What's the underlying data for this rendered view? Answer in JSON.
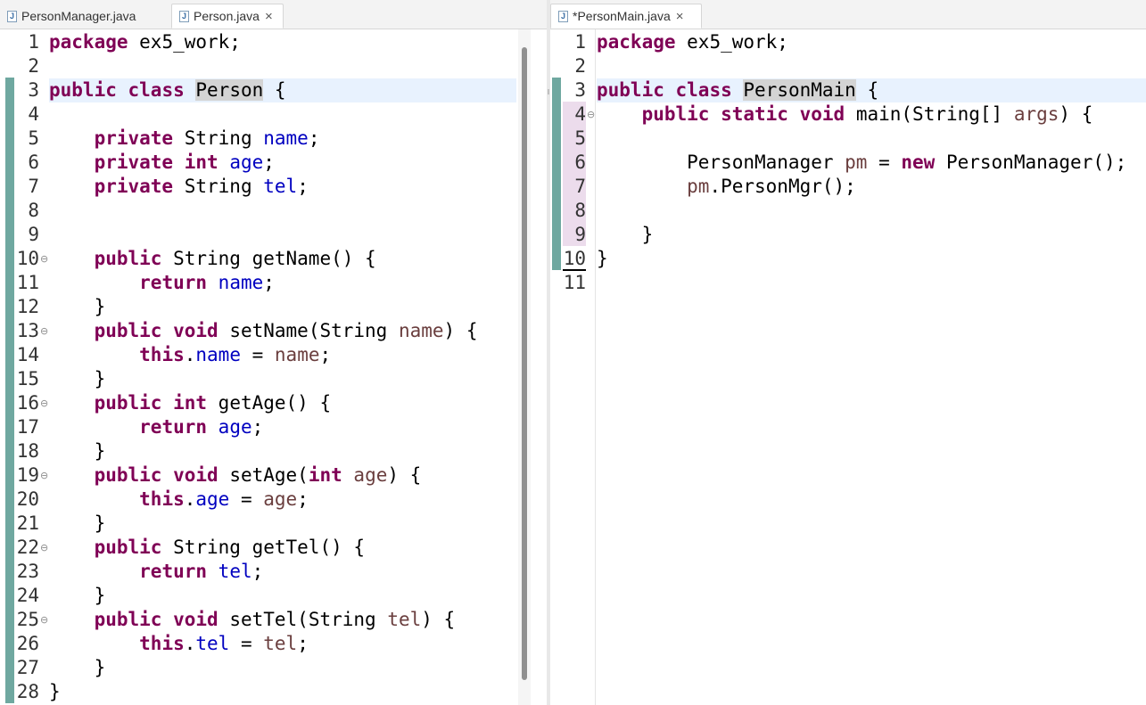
{
  "left": {
    "tabs": [
      {
        "label": "PersonManager.java",
        "active": false
      },
      {
        "label": "Person.java",
        "active": true,
        "close": "×"
      }
    ],
    "lines": [
      {
        "n": "1",
        "fold": "",
        "segs": [
          {
            "t": "package",
            "c": "kw"
          },
          {
            "t": " ex5_work;"
          }
        ]
      },
      {
        "n": "2",
        "fold": "",
        "segs": []
      },
      {
        "n": "3",
        "fold": "",
        "current": true,
        "segs": [
          {
            "t": "public",
            "c": "kw"
          },
          {
            "t": " "
          },
          {
            "t": "class",
            "c": "kw"
          },
          {
            "t": " "
          },
          {
            "t": "Person",
            "c": "hl"
          },
          {
            "t": " {"
          }
        ]
      },
      {
        "n": "4",
        "fold": "",
        "segs": []
      },
      {
        "n": "5",
        "fold": "",
        "segs": [
          {
            "t": "    "
          },
          {
            "t": "private",
            "c": "kw"
          },
          {
            "t": " String "
          },
          {
            "t": "name",
            "c": "fld"
          },
          {
            "t": ";"
          }
        ]
      },
      {
        "n": "6",
        "fold": "",
        "segs": [
          {
            "t": "    "
          },
          {
            "t": "private",
            "c": "kw"
          },
          {
            "t": " "
          },
          {
            "t": "int",
            "c": "kw"
          },
          {
            "t": " "
          },
          {
            "t": "age",
            "c": "fld"
          },
          {
            "t": ";"
          }
        ]
      },
      {
        "n": "7",
        "fold": "",
        "segs": [
          {
            "t": "    "
          },
          {
            "t": "private",
            "c": "kw"
          },
          {
            "t": " String "
          },
          {
            "t": "tel",
            "c": "fld"
          },
          {
            "t": ";"
          }
        ]
      },
      {
        "n": "8",
        "fold": "",
        "segs": []
      },
      {
        "n": "9",
        "fold": "",
        "segs": []
      },
      {
        "n": "10",
        "fold": "⊖",
        "segs": [
          {
            "t": "    "
          },
          {
            "t": "public",
            "c": "kw"
          },
          {
            "t": " String getName() {"
          }
        ]
      },
      {
        "n": "11",
        "fold": "",
        "segs": [
          {
            "t": "        "
          },
          {
            "t": "return",
            "c": "kw"
          },
          {
            "t": " "
          },
          {
            "t": "name",
            "c": "fld"
          },
          {
            "t": ";"
          }
        ]
      },
      {
        "n": "12",
        "fold": "",
        "segs": [
          {
            "t": "    }"
          }
        ]
      },
      {
        "n": "13",
        "fold": "⊖",
        "segs": [
          {
            "t": "    "
          },
          {
            "t": "public",
            "c": "kw"
          },
          {
            "t": " "
          },
          {
            "t": "void",
            "c": "kw"
          },
          {
            "t": " setName(String "
          },
          {
            "t": "name",
            "c": "par"
          },
          {
            "t": ") {"
          }
        ]
      },
      {
        "n": "14",
        "fold": "",
        "segs": [
          {
            "t": "        "
          },
          {
            "t": "this",
            "c": "kw"
          },
          {
            "t": "."
          },
          {
            "t": "name",
            "c": "fld"
          },
          {
            "t": " = "
          },
          {
            "t": "name",
            "c": "par"
          },
          {
            "t": ";"
          }
        ]
      },
      {
        "n": "15",
        "fold": "",
        "segs": [
          {
            "t": "    }"
          }
        ]
      },
      {
        "n": "16",
        "fold": "⊖",
        "segs": [
          {
            "t": "    "
          },
          {
            "t": "public",
            "c": "kw"
          },
          {
            "t": " "
          },
          {
            "t": "int",
            "c": "kw"
          },
          {
            "t": " getAge() {"
          }
        ]
      },
      {
        "n": "17",
        "fold": "",
        "segs": [
          {
            "t": "        "
          },
          {
            "t": "return",
            "c": "kw"
          },
          {
            "t": " "
          },
          {
            "t": "age",
            "c": "fld"
          },
          {
            "t": ";"
          }
        ]
      },
      {
        "n": "18",
        "fold": "",
        "segs": [
          {
            "t": "    }"
          }
        ]
      },
      {
        "n": "19",
        "fold": "⊖",
        "segs": [
          {
            "t": "    "
          },
          {
            "t": "public",
            "c": "kw"
          },
          {
            "t": " "
          },
          {
            "t": "void",
            "c": "kw"
          },
          {
            "t": " setAge("
          },
          {
            "t": "int",
            "c": "kw"
          },
          {
            "t": " "
          },
          {
            "t": "age",
            "c": "par"
          },
          {
            "t": ") {"
          }
        ]
      },
      {
        "n": "20",
        "fold": "",
        "segs": [
          {
            "t": "        "
          },
          {
            "t": "this",
            "c": "kw"
          },
          {
            "t": "."
          },
          {
            "t": "age",
            "c": "fld"
          },
          {
            "t": " = "
          },
          {
            "t": "age",
            "c": "par"
          },
          {
            "t": ";"
          }
        ]
      },
      {
        "n": "21",
        "fold": "",
        "segs": [
          {
            "t": "    }"
          }
        ]
      },
      {
        "n": "22",
        "fold": "⊖",
        "segs": [
          {
            "t": "    "
          },
          {
            "t": "public",
            "c": "kw"
          },
          {
            "t": " String getTel() {"
          }
        ]
      },
      {
        "n": "23",
        "fold": "",
        "segs": [
          {
            "t": "        "
          },
          {
            "t": "return",
            "c": "kw"
          },
          {
            "t": " "
          },
          {
            "t": "tel",
            "c": "fld"
          },
          {
            "t": ";"
          }
        ]
      },
      {
        "n": "24",
        "fold": "",
        "segs": [
          {
            "t": "    }"
          }
        ]
      },
      {
        "n": "25",
        "fold": "⊖",
        "segs": [
          {
            "t": "    "
          },
          {
            "t": "public",
            "c": "kw"
          },
          {
            "t": " "
          },
          {
            "t": "void",
            "c": "kw"
          },
          {
            "t": " setTel(String "
          },
          {
            "t": "tel",
            "c": "par"
          },
          {
            "t": ") {"
          }
        ]
      },
      {
        "n": "26",
        "fold": "",
        "segs": [
          {
            "t": "        "
          },
          {
            "t": "this",
            "c": "kw"
          },
          {
            "t": "."
          },
          {
            "t": "tel",
            "c": "fld"
          },
          {
            "t": " = "
          },
          {
            "t": "tel",
            "c": "par"
          },
          {
            "t": ";"
          }
        ]
      },
      {
        "n": "27",
        "fold": "",
        "segs": [
          {
            "t": "    }"
          }
        ]
      },
      {
        "n": "28",
        "fold": "",
        "segs": [
          {
            "t": "}"
          }
        ]
      }
    ]
  },
  "right": {
    "tabs": [
      {
        "label": "*PersonMain.java",
        "active": true,
        "close": "×"
      }
    ],
    "lines": [
      {
        "n": "1",
        "fold": "",
        "segs": [
          {
            "t": "package",
            "c": "kw"
          },
          {
            "t": " ex5_work;"
          }
        ]
      },
      {
        "n": "2",
        "fold": "",
        "segs": []
      },
      {
        "n": "3",
        "fold": "",
        "current": true,
        "segs": [
          {
            "t": "public",
            "c": "kw"
          },
          {
            "t": " "
          },
          {
            "t": "class",
            "c": "kw"
          },
          {
            "t": " "
          },
          {
            "t": "PersonMain",
            "c": "hl"
          },
          {
            "t": " {"
          }
        ]
      },
      {
        "n": "4",
        "fold": "⊖",
        "segs": [
          {
            "t": "    "
          },
          {
            "t": "public",
            "c": "kw"
          },
          {
            "t": " "
          },
          {
            "t": "static",
            "c": "kw"
          },
          {
            "t": " "
          },
          {
            "t": "void",
            "c": "kw"
          },
          {
            "t": " main(String[] "
          },
          {
            "t": "args",
            "c": "par"
          },
          {
            "t": ") {"
          }
        ]
      },
      {
        "n": "5",
        "fold": "",
        "segs": []
      },
      {
        "n": "6",
        "fold": "",
        "segs": [
          {
            "t": "        PersonManager "
          },
          {
            "t": "pm",
            "c": "par"
          },
          {
            "t": " = "
          },
          {
            "t": "new",
            "c": "kw"
          },
          {
            "t": " PersonManager();"
          }
        ]
      },
      {
        "n": "7",
        "fold": "",
        "segs": [
          {
            "t": "        "
          },
          {
            "t": "pm",
            "c": "par"
          },
          {
            "t": ".PersonMgr();"
          }
        ]
      },
      {
        "n": "8",
        "fold": "",
        "segs": []
      },
      {
        "n": "9",
        "fold": "",
        "segs": [
          {
            "t": "    }"
          }
        ]
      },
      {
        "n": "10",
        "fold": "",
        "segs": [
          {
            "t": "}"
          }
        ]
      },
      {
        "n": "11",
        "fold": "",
        "segs": []
      }
    ]
  },
  "colors": {
    "keyword": "#7f0055",
    "field": "#0000c0",
    "parameter": "#6a3e3e",
    "current_line": "#e8f2fe",
    "occurrence_highlight": "#d4d4d4",
    "quickdiff_bar": "#6fa8a0",
    "changed_range": "#ecdcec"
  }
}
